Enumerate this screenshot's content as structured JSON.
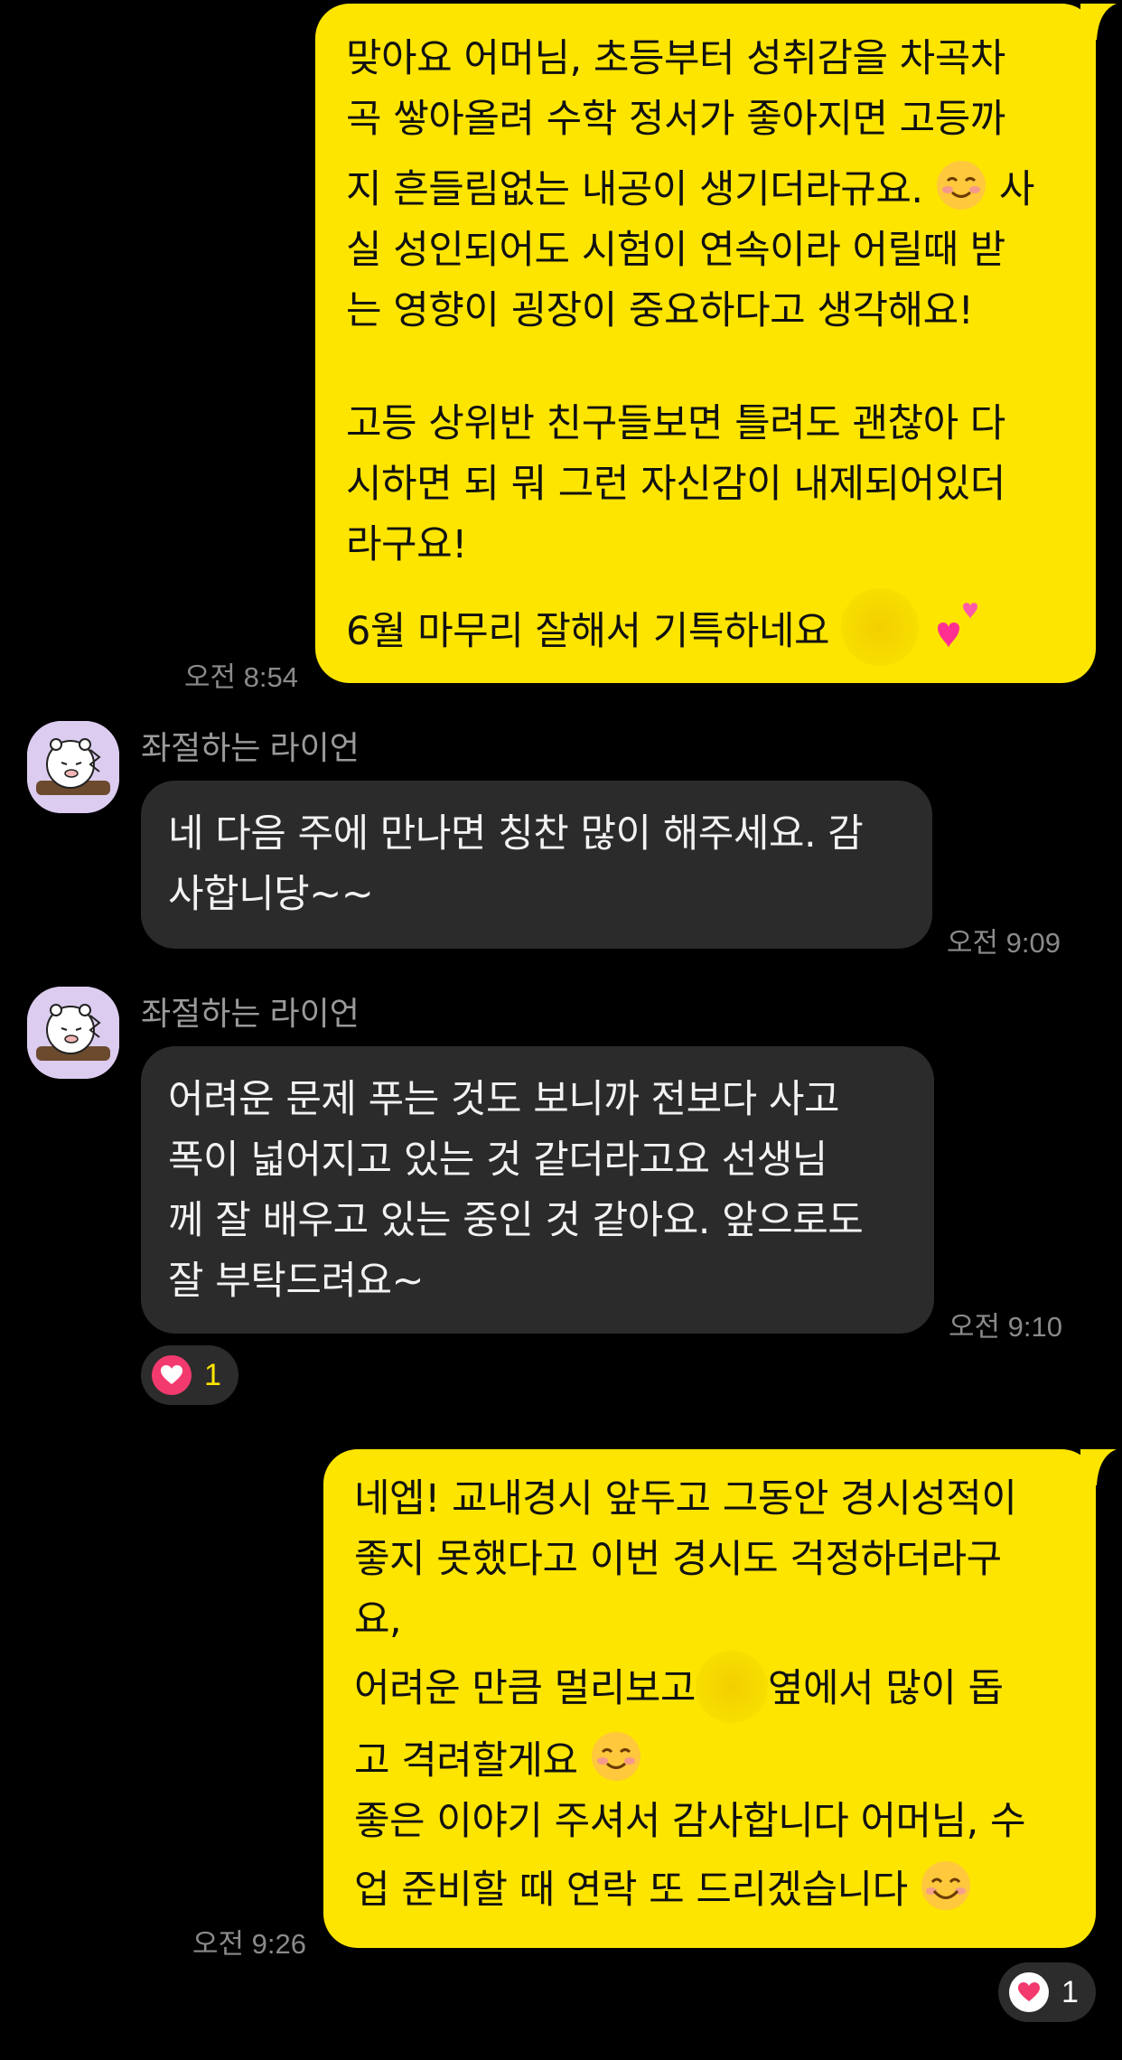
{
  "messages": [
    {
      "from": "me",
      "lines": [
        "맞아요 어머님, 초등부터 성취감을 차곡차",
        "곡 쌓아올려 수학 정서가 좋아지면 고등까",
        "지 흔들림없는 내공이 생기더라규요.",
        "사",
        "실 성인되어도 시험이 연속이라 어릴때 받",
        "는 영향이 굉장이 중요하다고 생각해요!",
        "고등 상위반 친구들보면 틀려도 괜찮아 다",
        "시하면 되 뭐 그런 자신감이 내제되어있더",
        "라구요!",
        "6월 마무리 잘해서 기특하네요"
      ],
      "time": "오전 8:54"
    },
    {
      "from": "other",
      "sender": "좌절하는 라이언",
      "lines": [
        "네 다음 주에 만나면 칭찬 많이 해주세요. 감",
        "사합니당~~"
      ],
      "time": "오전 9:09"
    },
    {
      "from": "other",
      "sender": "좌절하는 라이언",
      "lines": [
        "어려운 문제 푸는 것도 보니까 전보다 사고",
        "폭이 넓어지고 있는 것 같더라고요 선생님",
        "께 잘 배우고 있는 중인 것 같아요. 앞으로도",
        "잘 부탁드려요~"
      ],
      "time": "오전 9:10",
      "reaction": {
        "icon": "heart-icon",
        "count": "1"
      }
    },
    {
      "from": "me",
      "lines": [
        "네엡! 교내경시 앞두고 그동안 경시성적이",
        "좋지 못했다고 이번 경시도 걱정하더라구",
        "요,",
        "어려운 만큼 멀리보고",
        "옆에서 많이 돕",
        "고 격려할게요",
        "좋은 이야기 주셔서 감사합니다 어머님, 수",
        "업 준비할 때 연락 또 드리겠습니다"
      ],
      "time": "오전 9:26",
      "reaction": {
        "icon": "heart-icon",
        "count": "1"
      }
    }
  ],
  "colors": {
    "background": "#000000",
    "my_bubble": "#fee500",
    "other_bubble": "#2b2b2b",
    "reaction_heart": "#f23a6e"
  }
}
